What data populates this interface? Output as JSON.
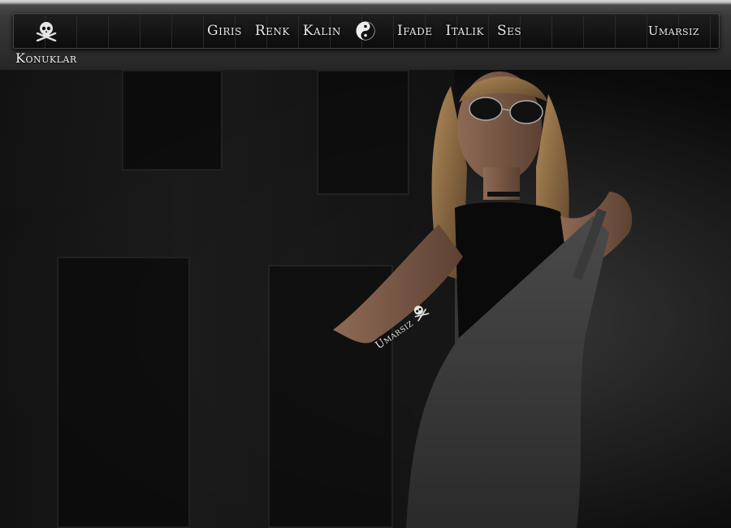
{
  "navbar": {
    "logo_icon": "skull-crossbones-icon",
    "menu_left": [
      "Giris",
      "Renk",
      "Kalin"
    ],
    "center_icon": "yin-yang-icon",
    "menu_right": [
      "Ifade",
      "Italik",
      "Ses"
    ],
    "user": "Umarsiz"
  },
  "side": {
    "guests": "Konuklar"
  },
  "hero": {
    "tattoo_text": "Umarsiz",
    "tattoo_icon": "skull-crossbones-icon"
  },
  "colors": {
    "text": "#e8e8e8",
    "navbar_bg": "#111111",
    "page_bg": "#050505"
  }
}
